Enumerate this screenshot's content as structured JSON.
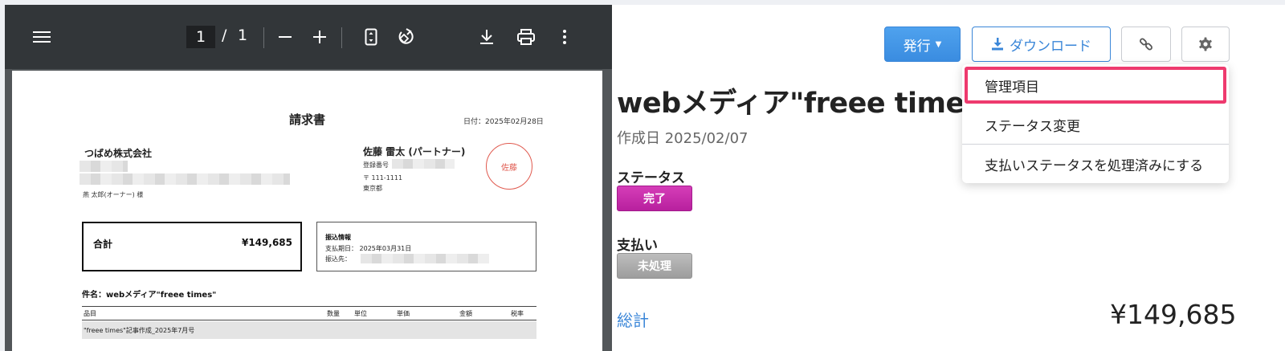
{
  "viewer": {
    "page_current": "1",
    "page_sep": "/",
    "page_total": "1",
    "icons": [
      "menu-icon",
      "zoom-out-icon",
      "zoom-in-icon",
      "fit-page-icon",
      "rotate-icon",
      "download-icon",
      "print-icon",
      "more-vert-icon"
    ]
  },
  "invoice": {
    "title": "請求書",
    "date": "日付：2025年02月28日",
    "client_name": "つばめ株式会社",
    "client_person": "燕 太郎(オーナー) 様",
    "issuer_name": "佐藤 雷太 (パートナー)",
    "issuer_reg": "登録番号",
    "issuer_zip": "〒 111-1111",
    "issuer_pref": "東京都",
    "seal_text": "佐藤",
    "total_label": "合計",
    "total_value": "¥149,685",
    "bank_title": "振込情報",
    "bank_due": "支払期日：  2025年03月31日",
    "bank_to": "振込先：",
    "subject": "件名：webメディア\"freee times\"",
    "columns": [
      "品目",
      "数量",
      "単位",
      "単価",
      "金額",
      "税率"
    ],
    "row1": "\"freee times\"記事作成_2025年7月号"
  },
  "toolbar": {
    "issue_label": "発行",
    "download_label": "ダウンロード"
  },
  "detail": {
    "title": "webメディア\"freee times\"",
    "created": "作成日 2025/02/07",
    "status_label": "ステータス",
    "status_value": "完了",
    "payment_label": "支払い",
    "payment_value": "未処理",
    "total_label": "総計",
    "total_value": "¥149,685"
  },
  "menu": {
    "items": [
      "管理項目",
      "ステータス変更",
      "支払いステータスを処理済みにする"
    ]
  },
  "colors": {
    "accent": "#3a86d8",
    "status_done": "#c62ba9",
    "status_unprocessed": "#a8a8a8",
    "highlight": "#ee3a6e"
  }
}
